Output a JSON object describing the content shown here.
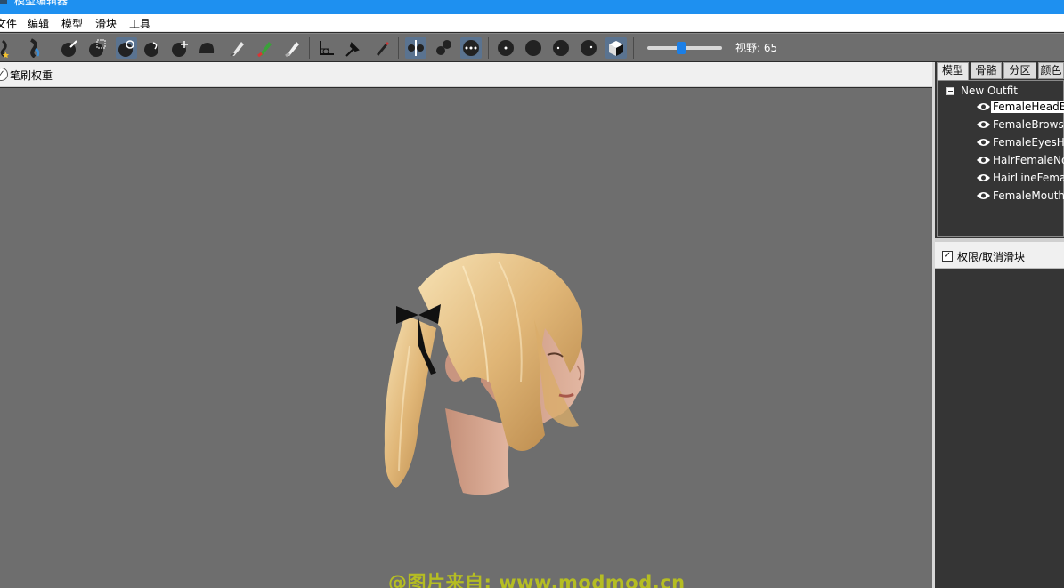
{
  "window": {
    "title": "模型编辑器"
  },
  "menu": [
    {
      "label": "文件"
    },
    {
      "label": "编辑"
    },
    {
      "label": "模型"
    },
    {
      "label": "滑块"
    },
    {
      "label": "工具"
    }
  ],
  "toolbar": {
    "fov_label": "视野: 65",
    "fov_value": 65
  },
  "viewport": {
    "brush_weight_label": "笔刷权重",
    "watermark": "@图片来自: www.modmod.cn"
  },
  "right_panel": {
    "tabs": [
      {
        "label": "模型"
      },
      {
        "label": "骨骼"
      },
      {
        "label": "分区"
      },
      {
        "label": "颜色"
      }
    ],
    "tree_root": "New Outfit",
    "tree_items": [
      {
        "label": "FemaleHeadBr"
      },
      {
        "label": "FemaleBrowsH"
      },
      {
        "label": "FemaleEyesHu"
      },
      {
        "label": "HairFemaleNo"
      },
      {
        "label": "HairLineFemal"
      },
      {
        "label": "FemaleMouthH"
      }
    ],
    "slider_limit_label": "权限/取消滑块"
  }
}
